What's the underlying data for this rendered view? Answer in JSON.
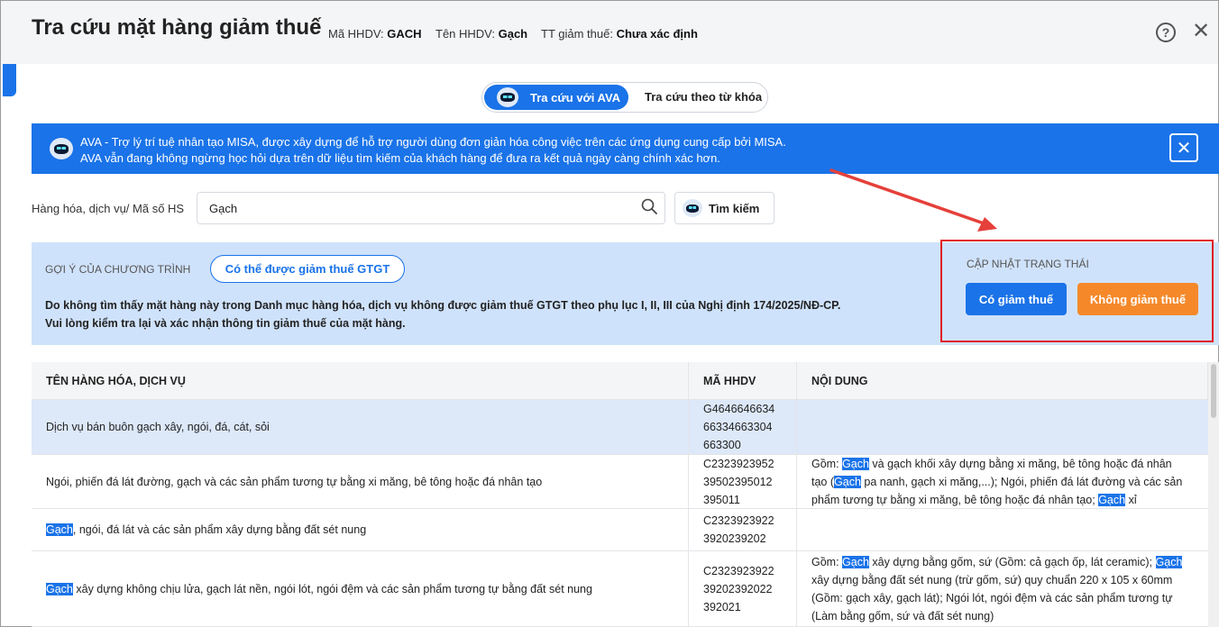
{
  "header": {
    "title": "Tra cứu mặt hàng giảm thuế",
    "code_label": "Mã HHDV:",
    "code_value": "GACH",
    "name_label": "Tên HHDV:",
    "name_value": "Gạch",
    "status_label": "TT giảm thuế:",
    "status_value": "Chưa xác định",
    "help_icon": "?",
    "close_icon": "✕"
  },
  "sidebar_toggle": "›",
  "mode_tabs": {
    "ava_label": "Tra cứu với AVA",
    "keyword_label": "Tra cứu theo từ khóa",
    "active": "ava"
  },
  "banner": {
    "line1": "AVA - Trợ lý trí tuệ nhân tạo MISA, được xây dựng để hỗ trợ người dùng đơn giản hóa công việc trên các ứng dụng cung cấp bởi MISA.",
    "line2": "AVA vẫn đang không ngừng học hỏi dựa trên dữ liệu tìm kiếm của khách hàng để đưa ra kết quả ngày càng chính xác hơn.",
    "close_icon": "✕"
  },
  "search": {
    "label": "Hàng hóa, dịch vụ/ Mã số HS",
    "value": "Gạch",
    "button_label": "Tìm kiếm"
  },
  "suggestion": {
    "caption": "GỢI Ý CỦA CHƯƠNG TRÌNH",
    "pill": "Có thể được giảm thuế GTGT",
    "message_line1": "Do không tìm thấy mặt hàng này trong Danh mục hàng hóa, dịch vụ không được giảm thuế GTGT theo phụ lục I, II, III của Nghị định 174/2025/NĐ-CP.",
    "message_line2": "Vui lòng kiểm tra lại và xác nhận thông tin giảm thuế của mặt hàng."
  },
  "status_update": {
    "caption": "CẬP NHẬT TRẠNG THÁI",
    "yes_label": "Có giảm thuế",
    "no_label": "Không giảm thuế"
  },
  "table": {
    "columns": [
      "TÊN HÀNG HÓA, DỊCH VỤ",
      "MÃ HHDV",
      "NỘI DUNG"
    ],
    "rows": [
      {
        "name": [
          {
            "t": "Dịch vụ bán buôn gạch xây, ngói, đá, cát, sỏi"
          }
        ],
        "code": [
          "G4646646634",
          "66334663304",
          "663300"
        ],
        "content": [],
        "selected": true
      },
      {
        "name": [
          {
            "t": "Ngói, phiến đá lát đường, gạch và các sản phẩm tương tự bằng xi măng, bê tông hoặc đá nhân tạo"
          }
        ],
        "code": [
          "C2323923952",
          "39502395012",
          "395011"
        ],
        "content": [
          [
            {
              "t": "Gồm: "
            },
            {
              "t": "Gạch",
              "hl": true
            },
            {
              "t": " và gạch khối xây dựng bằng xi măng, bê tông hoặc đá nhân"
            }
          ],
          [
            {
              "t": "tạo ("
            },
            {
              "t": "Gạch",
              "hl": true
            },
            {
              "t": " pa nanh, gạch xi măng,...); Ngói, phiến đá lát đường và các sản"
            }
          ],
          [
            {
              "t": "phẩm tương tự bằng xi măng, bê tông hoặc đá nhân tạo; "
            },
            {
              "t": "Gạch",
              "hl": true
            },
            {
              "t": " xỉ"
            }
          ]
        ],
        "selected": false
      },
      {
        "name": [
          {
            "t": "Gạch",
            "hl": true
          },
          {
            "t": ", ngói, đá lát và các sản phẩm xây dựng bằng đất sét nung"
          }
        ],
        "code": [
          "C2323923922",
          "3920239202"
        ],
        "content": [],
        "selected": false
      },
      {
        "name": [
          {
            "t": "Gạch",
            "hl": true
          },
          {
            "t": " xây dựng không chịu lửa, gạch lát nền, ngói lót, ngói đệm và các sản phẩm tương tự bằng đất sét nung"
          }
        ],
        "code": [
          "C2323923922",
          "39202392022",
          "392021"
        ],
        "content": [
          [
            {
              "t": "Gồm: "
            },
            {
              "t": "Gạch",
              "hl": true
            },
            {
              "t": " xây dựng bằng gốm, sứ (Gồm: cả gạch ốp, lát ceramic); "
            },
            {
              "t": "Gạch",
              "hl": true
            }
          ],
          [
            {
              "t": "xây dựng bằng đất sét nung (trừ gốm, sứ) quy chuẩn 220 x 105 x 60mm"
            }
          ],
          [
            {
              "t": "(Gồm: gạch xây, gạch lát); Ngói lót, ngói đệm và các sản phẩm tương tự"
            }
          ],
          [
            {
              "t": "(Làm bằng gốm, sứ và đất sét nung)"
            }
          ]
        ],
        "selected": false
      }
    ]
  },
  "colors": {
    "accent": "#1a73e8",
    "orange": "#f5892a",
    "highlight_border": "#e01b24",
    "arrow": "#e5403a"
  }
}
